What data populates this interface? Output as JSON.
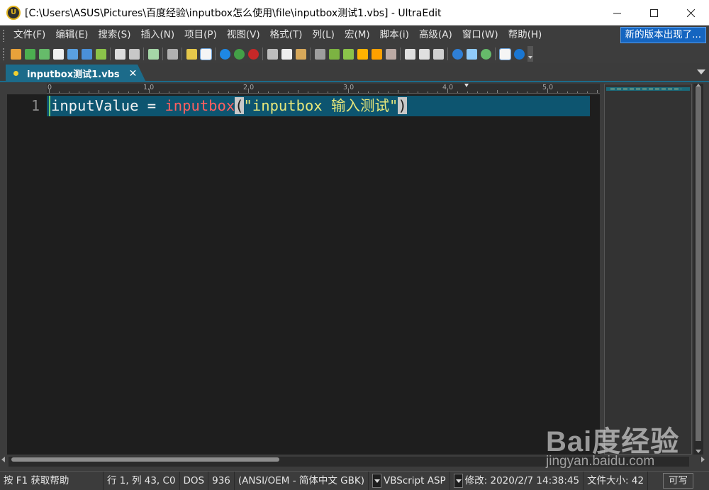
{
  "window": {
    "title": "[C:\\Users\\ASUS\\Pictures\\百度经验\\inputbox怎么使用\\file\\inputbox测试1.vbs] - UltraEdit",
    "app_icon_text": "U"
  },
  "menu": {
    "items": [
      "文件(F)",
      "编辑(E)",
      "搜索(S)",
      "插入(N)",
      "项目(P)",
      "视图(V)",
      "格式(T)",
      "列(L)",
      "宏(M)",
      "脚本(i)",
      "高级(A)",
      "窗口(W)",
      "帮助(H)"
    ],
    "update_button": "新的版本出现了..."
  },
  "toolbar": {
    "icons": [
      "new-file-icon",
      "back-icon",
      "forward-icon",
      "new-icon",
      "open-icon",
      "open-folder-icon",
      "save-icon",
      "print-icon",
      "print-preview-icon",
      "properties-icon",
      "find-files-icon",
      "column-mode-icon",
      "word-wrap-icon",
      "spell-check-icon",
      "compare-icon",
      "ftp-icon",
      "cut-icon",
      "copy-icon",
      "paste-icon",
      "find-icon",
      "find-next-icon",
      "replace-icon",
      "bookmark-icon",
      "toggle-bookmark-icon",
      "macro-icon",
      "split-horizontal-icon",
      "split-vertical-icon",
      "cascade-icon",
      "browser-icon",
      "screenshot-icon",
      "refresh-icon",
      "list-icon",
      "help-icon"
    ]
  },
  "tab": {
    "label": "inputbox测试1.vbs",
    "close": "✕"
  },
  "ruler": {
    "labels": [
      "0",
      "1,0",
      "2,0",
      "3,0",
      "4,0",
      "5,0"
    ]
  },
  "editor": {
    "line_number": "1",
    "tokens": {
      "ident": "inputValue",
      "op": " = ",
      "func": "inputbox",
      "lparen": "(",
      "str": "\"inputbox 输入测试\"",
      "rparen": ")"
    }
  },
  "status": {
    "help": "按 F1 获取帮助",
    "position": "行 1, 列 43, C0",
    "line_ending": "DOS",
    "codepage": "936",
    "encoding": "(ANSI/OEM - 简体中文 GBK)",
    "syntax": "VBScript ASP",
    "modified": "修改:   2020/2/7 14:38:45",
    "filesize": "文件大小:   42",
    "rw": "可写"
  },
  "watermark": {
    "main": "Bai度经验",
    "sub": "jingyan.baidu.com"
  },
  "colors": {
    "tab_accent": "#1c6b8a",
    "line_highlight": "#0d5570",
    "editor_bg": "#1e1e1e",
    "keyword_red": "#ff5f5f",
    "string_yellow": "#e6e67a",
    "update_blue": "#1565c0"
  }
}
